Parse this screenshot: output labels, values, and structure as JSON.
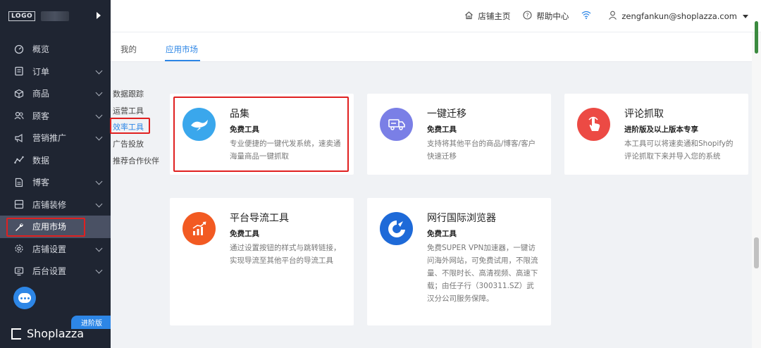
{
  "sidebar": {
    "logo_text": "LOGO",
    "items": [
      {
        "label": "概览",
        "icon": "dashboard-icon",
        "chevron": false
      },
      {
        "label": "订单",
        "icon": "order-icon",
        "chevron": true
      },
      {
        "label": "商品",
        "icon": "box-icon",
        "chevron": true
      },
      {
        "label": "顾客",
        "icon": "users-icon",
        "chevron": true
      },
      {
        "label": "营销推广",
        "icon": "megaphone-icon",
        "chevron": true
      },
      {
        "label": "数据",
        "icon": "chart-icon",
        "chevron": false
      },
      {
        "label": "博客",
        "icon": "blog-icon",
        "chevron": true
      },
      {
        "label": "店铺装修",
        "icon": "layout-icon",
        "chevron": true
      },
      {
        "label": "应用市场",
        "icon": "wrench-icon",
        "chevron": false,
        "active": true
      },
      {
        "label": "店铺设置",
        "icon": "settings-icon",
        "chevron": true
      },
      {
        "label": "后台设置",
        "icon": "monitor-icon",
        "chevron": true
      }
    ],
    "plan_badge": "进阶版",
    "brand": "Shoplazza"
  },
  "topbar": {
    "store_home": "店铺主页",
    "help_center": "帮助中心",
    "account": "zengfankun@shoplazza.com"
  },
  "tabs": [
    {
      "label": "我的",
      "active": false
    },
    {
      "label": "应用市场",
      "active": true
    }
  ],
  "categories": [
    {
      "label": "数据跟踪",
      "active": false
    },
    {
      "label": "运营工具",
      "active": false
    },
    {
      "label": "效率工具",
      "active": true
    },
    {
      "label": "广告投放",
      "active": false
    },
    {
      "label": "推荐合作伙伴",
      "active": false
    }
  ],
  "apps": [
    {
      "title": "品集",
      "tag": "免费工具",
      "desc": "专业便捷的一键代发系统，速卖通海量商品一键抓取",
      "color": "#3aa7ec",
      "icon": "whale-icon"
    },
    {
      "title": "一键迁移",
      "tag": "免费工具",
      "desc": "支持将其他平台的商品/博客/客户快速迁移",
      "color": "#7a7fe6",
      "icon": "truck-icon"
    },
    {
      "title": "评论抓取",
      "tag": "进阶版及以上版本专享",
      "desc": "本工具可以将速卖通和Shopify的评论抓取下来并导入您的系统",
      "color": "#ec4a44",
      "icon": "hand-click-icon"
    },
    {
      "title": "平台导流工具",
      "tag": "免费工具",
      "desc": "通过设置按钮的样式与跳转链接，实现导流至其他平台的导流工具",
      "color": "#f25a22",
      "icon": "growth-chart-icon"
    },
    {
      "title": "网行国际浏览器",
      "tag": "免费工具",
      "desc": "免费SUPER VPN加速器，一键访问海外网站，可免费试用，不限流量、不限时长、高清视频、高速下载；由任子行（300311.SZ）武汉分公司服务保障。",
      "color": "#1e6ad8",
      "icon": "browser-logo-icon"
    }
  ]
}
